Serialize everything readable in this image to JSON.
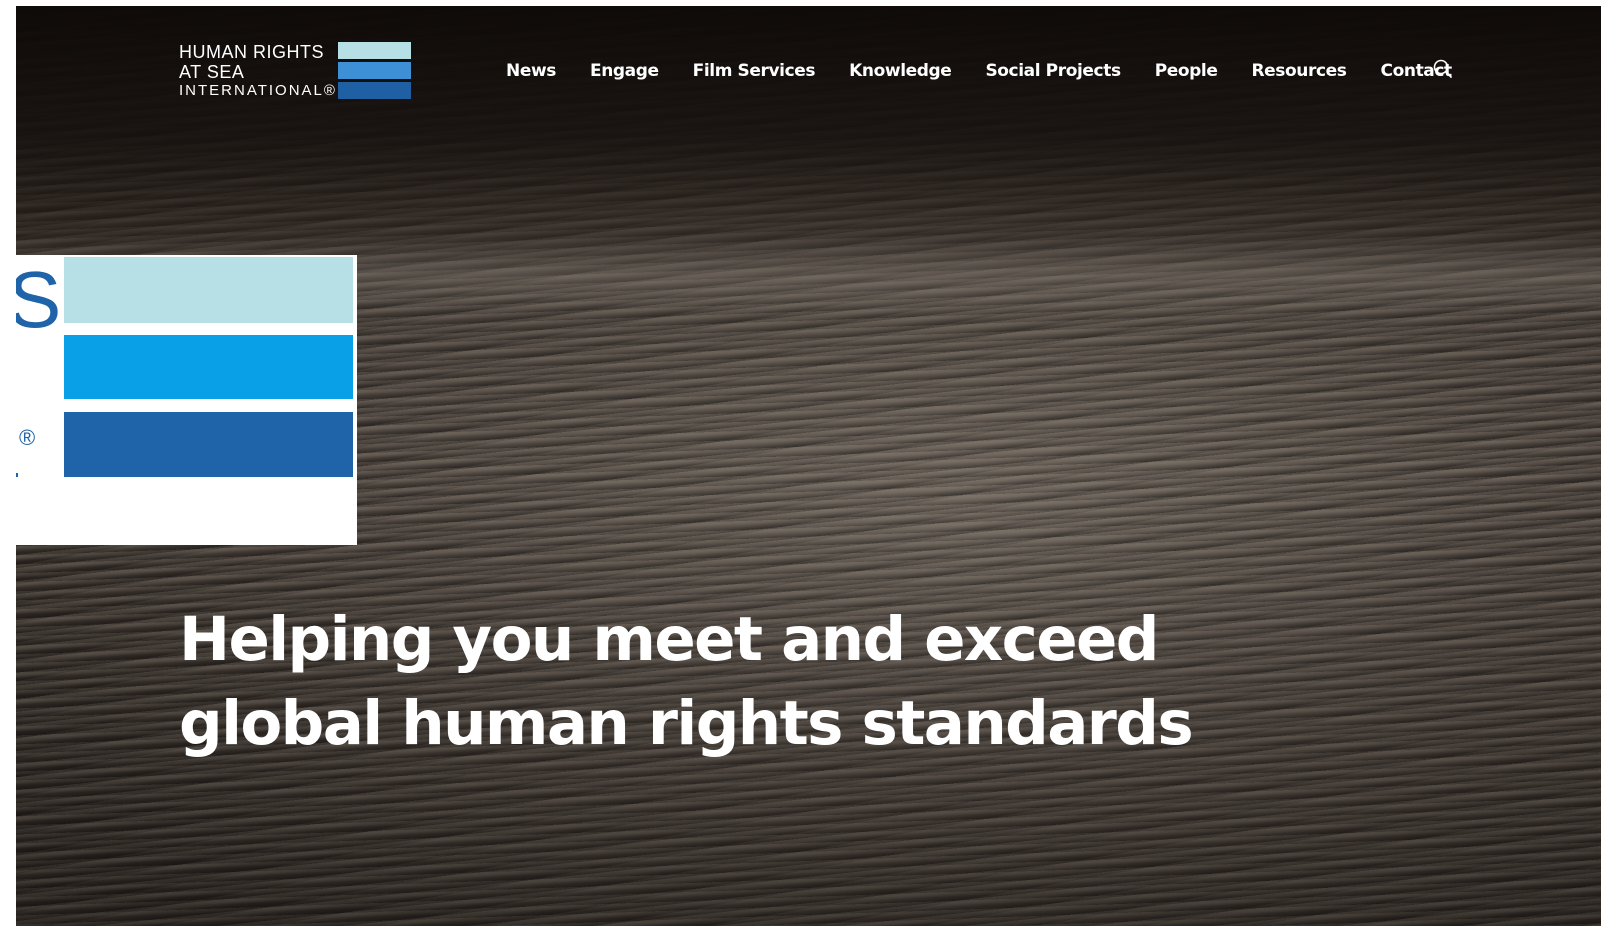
{
  "logo": {
    "line1": "HUMAN RIGHTS",
    "line2": "AT SEA",
    "line3": "INTERNATIONAL®",
    "bar_colors": [
      "#b7dfe6",
      "#3d8fd6",
      "#1f5fa3"
    ]
  },
  "nav": {
    "items": [
      {
        "label": "News"
      },
      {
        "label": "Engage"
      },
      {
        "label": "Film Services"
      },
      {
        "label": "Knowledge"
      },
      {
        "label": "Social Projects"
      },
      {
        "label": "People"
      },
      {
        "label": "Resources"
      },
      {
        "label": "Contact"
      }
    ],
    "search_icon": "search-icon"
  },
  "overlay_logo": {
    "letter": "S",
    "registered": "®",
    "bar_colors": [
      "#b7dfe6",
      "#0aa0e8",
      "#1f63a8"
    ]
  },
  "hero": {
    "headline_line1": "Helping you meet and exceed",
    "headline_line2": "global human rights standards"
  },
  "colors": {
    "text": "#ffffff",
    "brand_blue": "#1f63a8"
  }
}
